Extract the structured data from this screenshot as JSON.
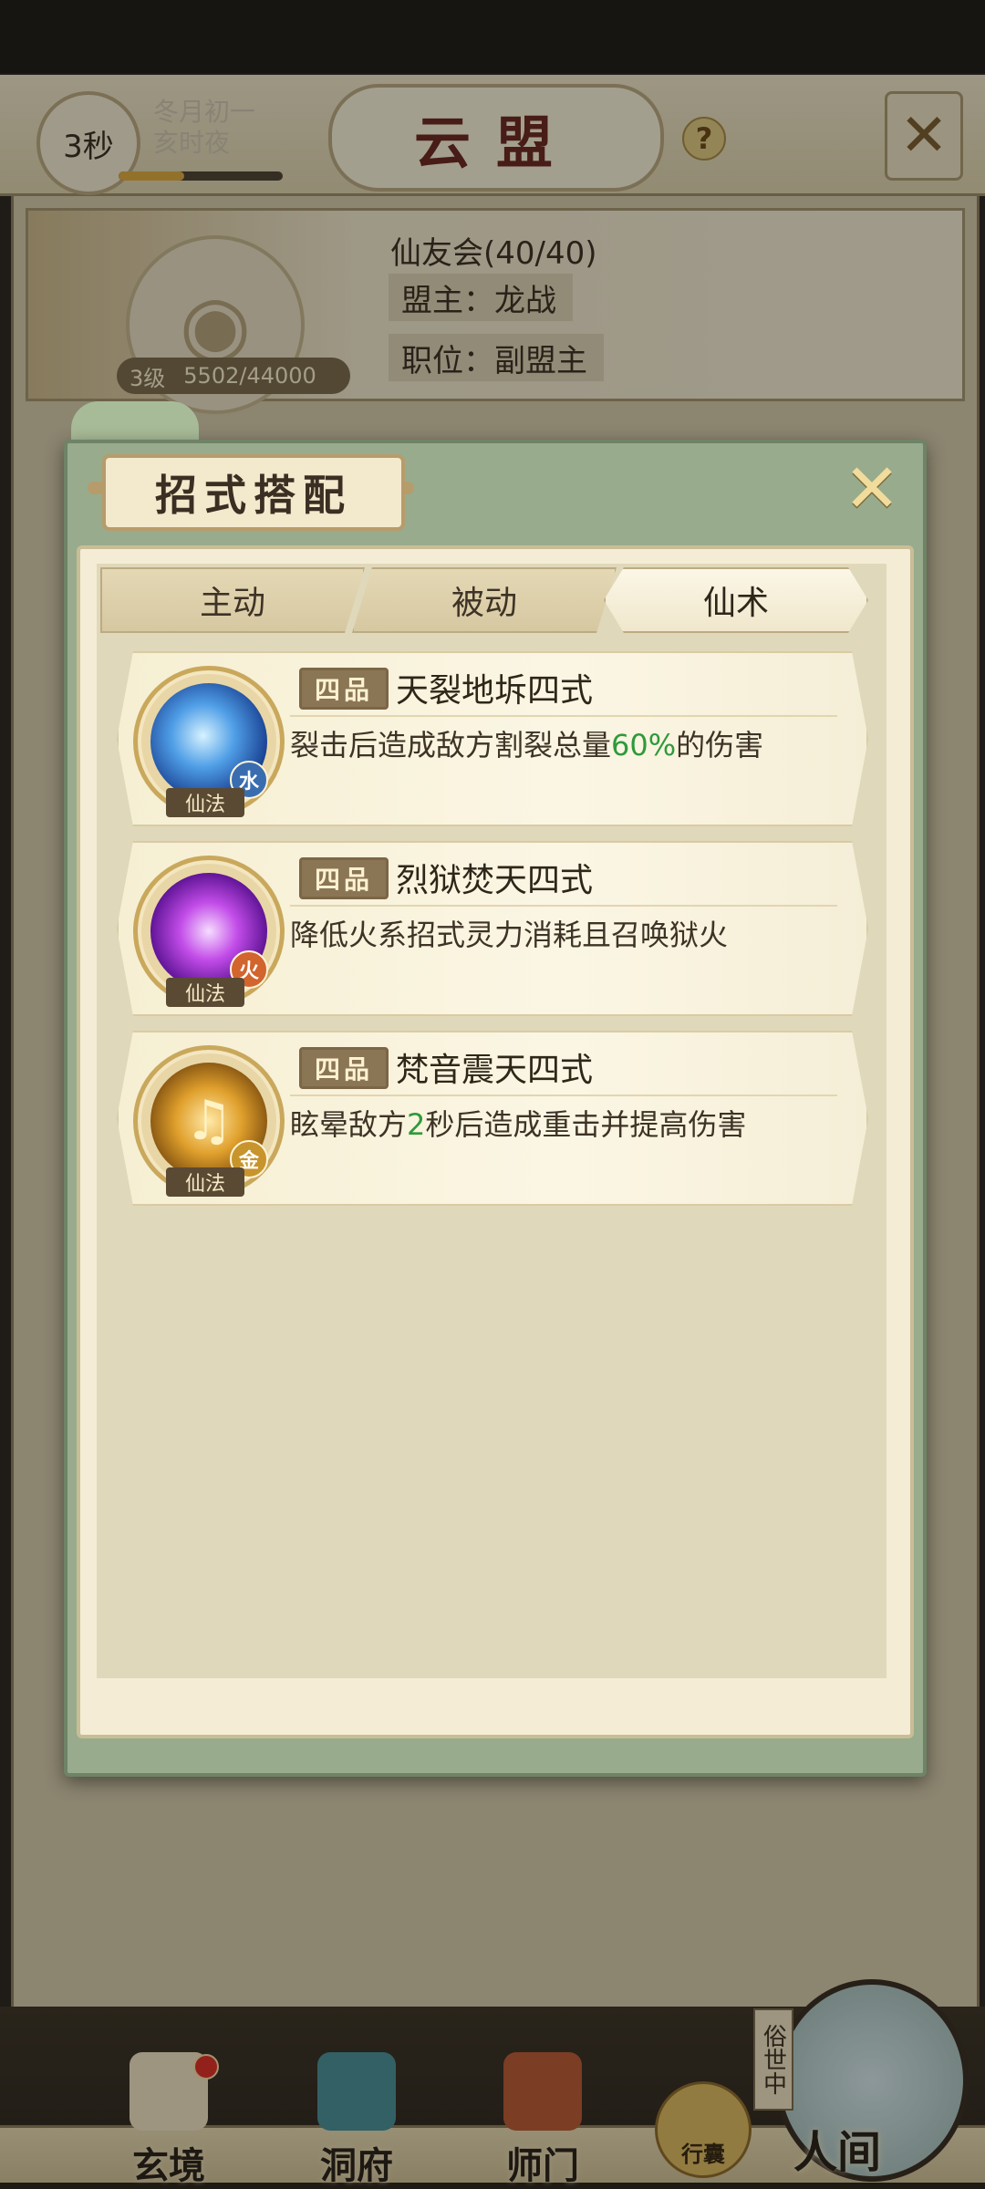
{
  "header": {
    "timer": "3秒",
    "date_line1": "冬月初一",
    "date_line2": "亥时夜",
    "title": "云盟",
    "help_label": "?"
  },
  "guild": {
    "name": "仙友会(40/40)",
    "leader": "盟主：龙战",
    "position": "职位：副盟主",
    "level": "3级",
    "exp": "5502/44000"
  },
  "modal": {
    "title": "招式搭配",
    "tabs": [
      {
        "label": "主动",
        "active": false
      },
      {
        "label": "被动",
        "active": false
      },
      {
        "label": "仙术",
        "active": true
      }
    ],
    "skills": [
      {
        "grade": "四品",
        "name": "天裂地坼四式",
        "desc_before": "裂击后造成敌方割裂总量",
        "desc_highlight": "60%",
        "desc_after": "的伤害",
        "element": "水",
        "element_color": "#3a6db0",
        "type": "仙法",
        "icon": "water-crystal-icon"
      },
      {
        "grade": "四品",
        "name": "烈狱焚天四式",
        "desc_before": "降低火系招式灵力消耗且召唤狱火",
        "desc_highlight": "",
        "desc_after": "",
        "element": "火",
        "element_color": "#d2642e",
        "type": "仙法",
        "icon": "purple-flame-icon"
      },
      {
        "grade": "四品",
        "name": "梵音震天四式",
        "desc_before": "眩晕敌方",
        "desc_highlight": "2",
        "desc_after": "秒后造成重击并提高伤害",
        "element": "金",
        "element_color": "#c8942c",
        "type": "仙法",
        "icon": "music-note-icon"
      }
    ]
  },
  "bottom_nav": {
    "items": [
      "玄境",
      "洞府",
      "师门"
    ],
    "bag_label": "行囊",
    "realm_tag": "俗世中",
    "realm_label": "人间"
  },
  "colors": {
    "modal_frame": "#98ab8c",
    "highlight_green": "#2f9a3a",
    "title_red": "#6a2a22"
  }
}
